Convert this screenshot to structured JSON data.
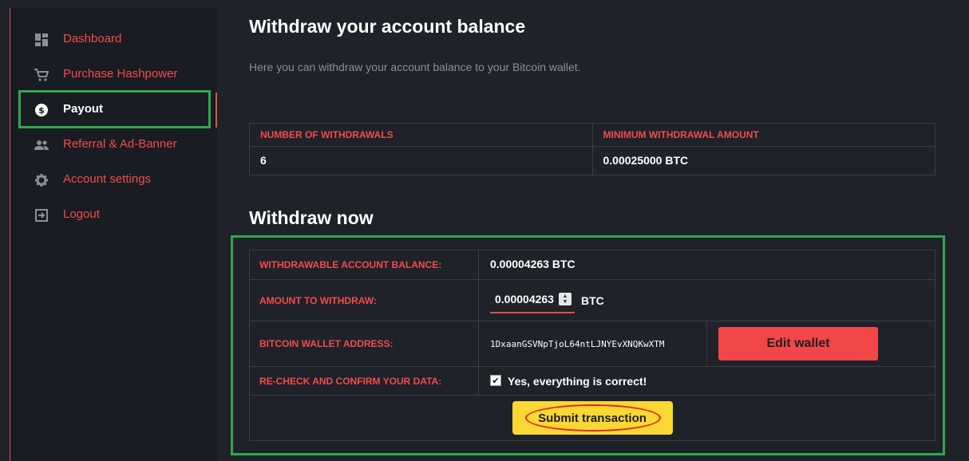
{
  "sidebar": {
    "items": [
      {
        "label": "Dashboard",
        "icon": "dashboard-icon"
      },
      {
        "label": "Purchase Hashpower",
        "icon": "cart-icon"
      },
      {
        "label": "Payout",
        "icon": "dollar-circle-icon",
        "active": true
      },
      {
        "label": "Referral & Ad-Banner",
        "icon": "people-icon"
      },
      {
        "label": "Account settings",
        "icon": "gear-icon"
      },
      {
        "label": "Logout",
        "icon": "logout-icon"
      }
    ]
  },
  "header": {
    "title": "Withdraw your account balance",
    "subtitle": "Here you can withdraw your account balance to your Bitcoin wallet."
  },
  "stats": {
    "col1_header": "NUMBER OF WITHDRAWALS",
    "col2_header": "MINIMUM WITHDRAWAL AMOUNT",
    "col1_value": "6",
    "col2_value": "0.00025000 BTC"
  },
  "withdraw": {
    "title": "Withdraw now",
    "balance_label": "WITHDRAWABLE ACCOUNT BALANCE:",
    "balance_value": "0.00004263 BTC",
    "amount_label": "AMOUNT TO WITHDRAW:",
    "amount_value": "0.00004263",
    "amount_unit": "BTC",
    "wallet_label": "BITCOIN WALLET ADDRESS:",
    "wallet_value": "1DxaanGSVNpTjoL64ntLJNYEvXNQKwXTM",
    "edit_wallet": "Edit wallet",
    "confirm_label": "RE-CHECK AND CONFIRM YOUR DATA:",
    "confirm_text": "Yes, everything is correct!",
    "confirm_checked": true,
    "submit": "Submit transaction"
  },
  "colors": {
    "accent_red": "#f24c4c",
    "highlight_green": "#2fa84b",
    "submit_yellow": "#f9d833",
    "background": "#1f2229",
    "sidebar_bg": "#191c22"
  }
}
